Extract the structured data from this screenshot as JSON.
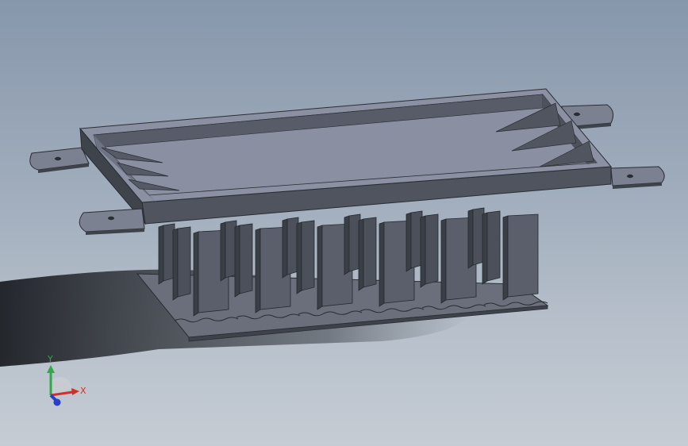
{
  "app": {
    "background_top": "#8797ab",
    "background_bottom": "#c5ccd4",
    "model_color": "#5c6270",
    "model_top_color": "#868c9e"
  },
  "triad": {
    "x_label": "X",
    "y_label": "Y",
    "x_color": "#d0302a",
    "y_color": "#2ea84a",
    "z_color": "#2a3fc8"
  }
}
